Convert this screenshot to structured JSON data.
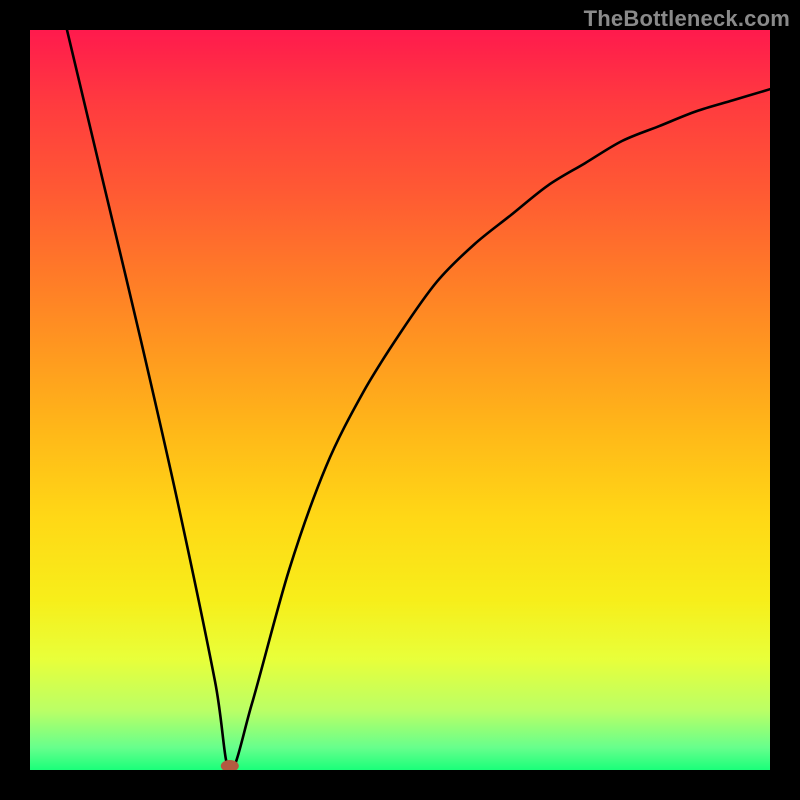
{
  "watermark": "TheBottleneck.com",
  "chart_data": {
    "type": "line",
    "title": "",
    "xlabel": "",
    "ylabel": "",
    "xlim": [
      0,
      100
    ],
    "ylim": [
      0,
      100
    ],
    "grid": false,
    "legend": false,
    "series": [
      {
        "name": "curve",
        "x": [
          5,
          10,
          15,
          20,
          25,
          27,
          30,
          35,
          40,
          45,
          50,
          55,
          60,
          65,
          70,
          75,
          80,
          85,
          90,
          95,
          100
        ],
        "y": [
          100,
          79,
          58,
          36,
          12,
          0,
          9,
          27,
          41,
          51,
          59,
          66,
          71,
          75,
          79,
          82,
          85,
          87,
          89,
          90.5,
          92
        ]
      }
    ],
    "marker": {
      "x": 27,
      "y": 0,
      "color": "#b35a40"
    },
    "background_gradient": {
      "top": "#ff1a4d",
      "bottom": "#1aff7a",
      "stops": [
        "#ff1a4d",
        "#ff5a33",
        "#ff9a1f",
        "#ffd816",
        "#e8ff3a",
        "#1aff7a"
      ]
    }
  }
}
